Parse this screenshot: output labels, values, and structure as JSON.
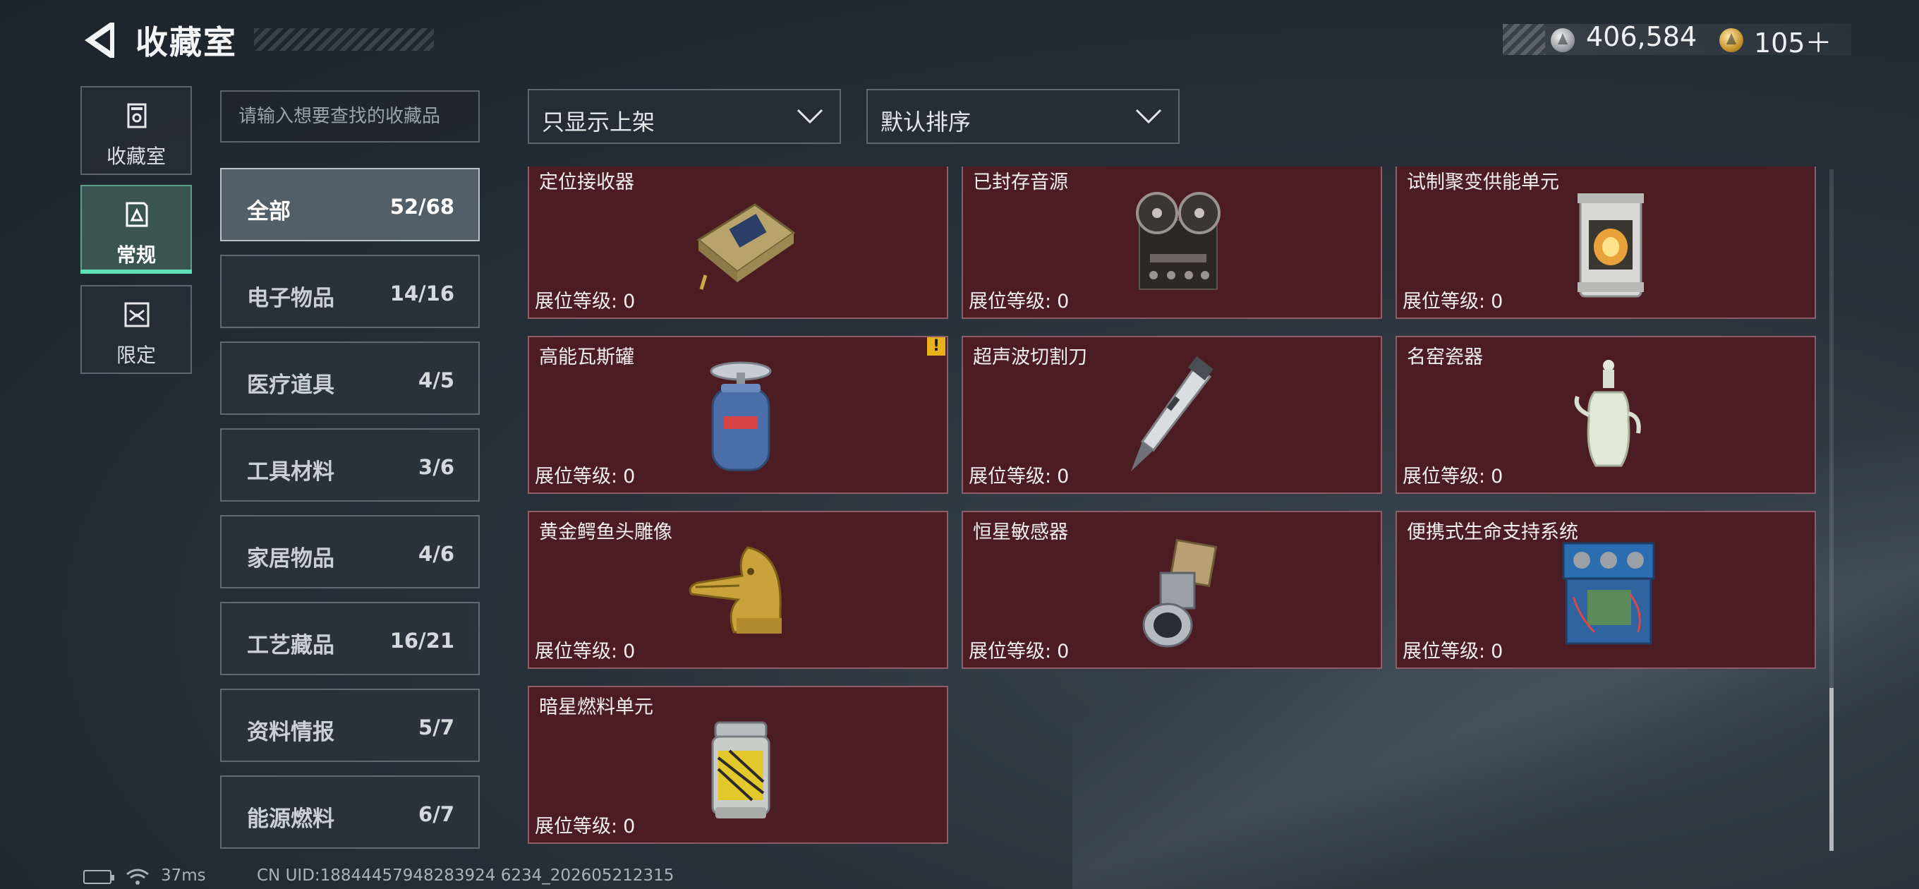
{
  "header": {
    "title": "收藏室",
    "currency": [
      {
        "icon": "silver-coin-icon",
        "value": "406,584"
      },
      {
        "icon": "gold-coin-icon",
        "value": "105＋"
      }
    ]
  },
  "rail": [
    {
      "label": "收藏室",
      "icon": "collection-room-icon",
      "active": false
    },
    {
      "label": "常规",
      "icon": "regular-book-icon",
      "active": true
    },
    {
      "label": "限定",
      "icon": "limited-icon",
      "active": false
    }
  ],
  "search": {
    "placeholder": "请输入想要查找的收藏品",
    "value": ""
  },
  "categories": [
    {
      "name": "全部",
      "count": "52/68",
      "active": true
    },
    {
      "name": "电子物品",
      "count": "14/16",
      "active": false
    },
    {
      "name": "医疗道具",
      "count": "4/5",
      "active": false
    },
    {
      "name": "工具材料",
      "count": "3/6",
      "active": false
    },
    {
      "name": "家居物品",
      "count": "4/6",
      "active": false
    },
    {
      "name": "工艺藏品",
      "count": "16/21",
      "active": false
    },
    {
      "name": "资料情报",
      "count": "5/7",
      "active": false
    },
    {
      "name": "能源燃料",
      "count": "6/7",
      "active": false
    }
  ],
  "filters": {
    "show_filter": "只显示上架",
    "sort": "默认排序"
  },
  "level_label": "展位等级:",
  "items": [
    {
      "name": "定位接收器",
      "level": "0",
      "icon": "locator-receiver-icon",
      "warning": false
    },
    {
      "name": "已封存音源",
      "level": "0",
      "icon": "reel-tape-recorder-icon",
      "warning": false
    },
    {
      "name": "试制聚变供能单元",
      "level": "0",
      "icon": "fusion-power-unit-icon",
      "warning": false
    },
    {
      "name": "高能瓦斯罐",
      "level": "0",
      "icon": "gas-canister-icon",
      "warning": true
    },
    {
      "name": "超声波切割刀",
      "level": "0",
      "icon": "ultrasonic-cutter-icon",
      "warning": false
    },
    {
      "name": "名窑瓷器",
      "level": "0",
      "icon": "porcelain-vase-icon",
      "warning": false
    },
    {
      "name": "黄金鳄鱼头雕像",
      "level": "0",
      "icon": "golden-crocodile-statue-icon",
      "warning": false
    },
    {
      "name": "恒星敏感器",
      "level": "0",
      "icon": "star-sensor-icon",
      "warning": false
    },
    {
      "name": "便携式生命支持系统",
      "level": "0",
      "icon": "life-support-system-icon",
      "warning": false
    },
    {
      "name": "暗星燃料单元",
      "level": "0",
      "icon": "fuel-cell-icon",
      "warning": false
    }
  ],
  "warning_glyph": "!",
  "status": {
    "ping": "37ms",
    "uid": "CN UID:18844457948283924 6234_202605212315"
  }
}
